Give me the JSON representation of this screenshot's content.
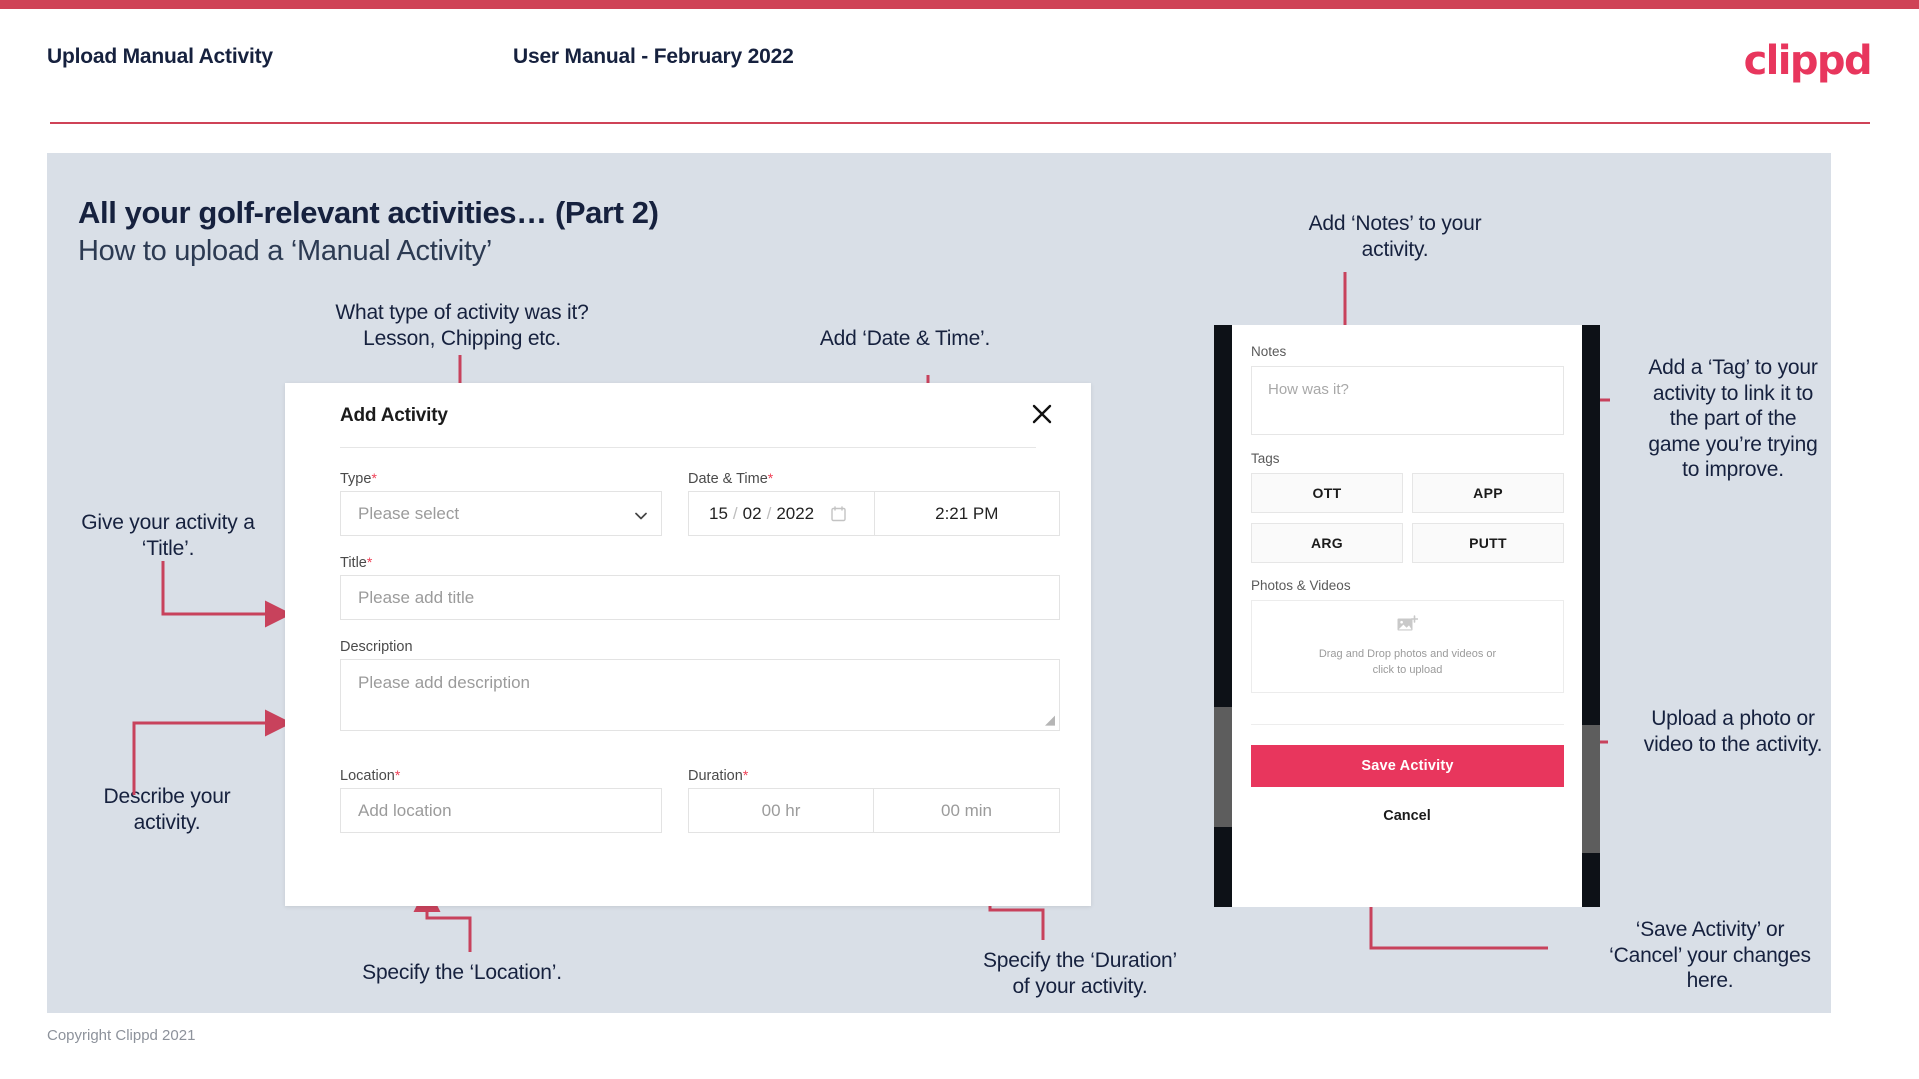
{
  "header": {
    "title": "Upload Manual Activity",
    "subtitle": "User Manual - February 2022",
    "logo": "clippd"
  },
  "slide": {
    "title": "All your golf-relevant activities… (Part 2)",
    "subtitle": "How to upload a ‘Manual Activity’"
  },
  "annotations": {
    "type": "What type of activity was it?\nLesson, Chipping etc.",
    "datetime": "Add ‘Date & Time’.",
    "title": "Give your activity a\n‘Title’.",
    "description": "Describe your\nactivity.",
    "location": "Specify the ‘Location’.",
    "duration": "Specify the ‘Duration’\nof your activity.",
    "notes": "Add ‘Notes’ to your\nactivity.",
    "tags": "Add a ‘Tag’ to your\nactivity to link it to\nthe part of the\ngame you’re trying\nto improve.",
    "photos": "Upload a photo or\nvideo to the activity.",
    "save": "‘Save Activity’ or\n‘Cancel’ your changes\nhere."
  },
  "dialog": {
    "title": "Add Activity",
    "close_icon": "close-icon",
    "fields": {
      "type": {
        "label": "Type",
        "required": "*",
        "placeholder": "Please select",
        "chevron_icon": "chevron-down-icon"
      },
      "datetime": {
        "label": "Date & Time",
        "required": "*",
        "day": "15",
        "sep1": "/",
        "month": "02",
        "sep2": "/",
        "year": "2022",
        "calendar_icon": "calendar-icon",
        "time": "2:21 PM"
      },
      "title": {
        "label": "Title",
        "required": "*",
        "placeholder": "Please add title"
      },
      "description": {
        "label": "Description",
        "required": "",
        "placeholder": "Please add description"
      },
      "location": {
        "label": "Location",
        "required": "*",
        "placeholder": "Add location"
      },
      "duration": {
        "label": "Duration",
        "required": "*",
        "hours_placeholder": "00 hr",
        "minutes_placeholder": "00 min"
      }
    }
  },
  "phone": {
    "notes_label": "Notes",
    "notes_placeholder": "How was it?",
    "tags_label": "Tags",
    "tags": [
      "OTT",
      "APP",
      "ARG",
      "PUTT"
    ],
    "photos_label": "Photos & Videos",
    "dropzone_icon": "add-image-icon",
    "dropzone_line1": "Drag and Drop photos and videos or",
    "dropzone_line2": "click to upload",
    "save_label": "Save Activity",
    "cancel_label": "Cancel"
  },
  "footer": {
    "copyright": "Copyright Clippd 2021"
  },
  "colors": {
    "brand": "#e8365d",
    "accent_bar": "#cf4357",
    "slide_bg": "#d9dfe7",
    "text_dark": "#16213e",
    "arrow": "#c8425c"
  }
}
